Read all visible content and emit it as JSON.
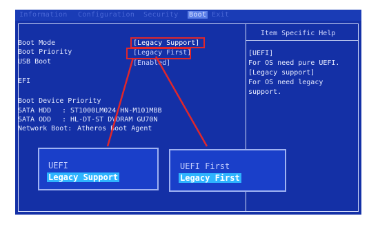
{
  "menu": {
    "tabs": [
      "Information",
      "Configuration",
      "Security",
      "Boot",
      "Exit"
    ],
    "active_tab": "Boot"
  },
  "settings": {
    "boot_mode": {
      "label": "Boot Mode",
      "value": "[Legacy Support]"
    },
    "boot_priority": {
      "label": "Boot Priority",
      "value": "[Legacy First]"
    },
    "usb_boot": {
      "label": "USB Boot",
      "value": "[Enabled]"
    },
    "efi": {
      "label": "EFI"
    }
  },
  "device_priority": {
    "title": "Boot Device Priority",
    "sata_hdd": {
      "label": "SATA HDD",
      "value": ": ST1000LM024 HN-M101MBB"
    },
    "sata_odd": {
      "label": "SATA ODD",
      "value": ": HL-DT-ST DVDRAM GU70N"
    },
    "network": {
      "label": "Network Boot:",
      "value": "Atheros Boot Agent"
    }
  },
  "help": {
    "title": "Item Specific Help",
    "lines": [
      "[UEFI]",
      "For OS need pure UEFI.",
      "[Legacy support]",
      "For OS need legacy",
      "support."
    ]
  },
  "popups": {
    "boot_mode": {
      "options": [
        "UEFI",
        "Legacy Support"
      ],
      "selected": "Legacy Support"
    },
    "boot_priority": {
      "options": [
        "UEFI First",
        "Legacy First"
      ],
      "selected": "Legacy First"
    }
  },
  "colors": {
    "screen_bg": "#1430a6",
    "highlight": "#2eb4ff",
    "annotation_red": "#e0272b"
  }
}
